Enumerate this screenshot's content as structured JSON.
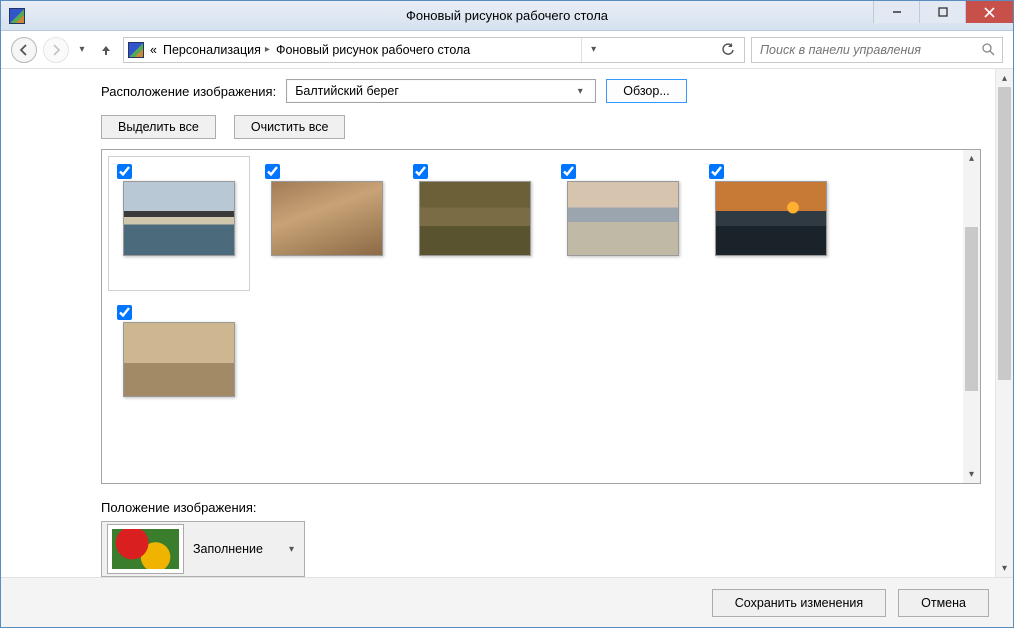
{
  "window_title": "Фоновый рисунок рабочего стола",
  "breadcrumb": {
    "prefix": "«",
    "items": [
      "Персонализация",
      "Фоновый рисунок рабочего стола"
    ]
  },
  "search": {
    "placeholder": "Поиск в панели управления"
  },
  "location": {
    "label": "Расположение изображения:",
    "value": "Балтийский берег",
    "browse": "Обзор..."
  },
  "buttons": {
    "select_all": "Выделить все",
    "clear_all": "Очистить все"
  },
  "images": [
    {
      "checked": true,
      "class": "img1"
    },
    {
      "checked": true,
      "class": "img2"
    },
    {
      "checked": true,
      "class": "img3"
    },
    {
      "checked": true,
      "class": "img4"
    },
    {
      "checked": true,
      "class": "img5"
    },
    {
      "checked": true,
      "class": "img6"
    }
  ],
  "position": {
    "label": "Положение изображения:",
    "value": "Заполнение"
  },
  "footer": {
    "save": "Сохранить изменения",
    "cancel": "Отмена"
  }
}
